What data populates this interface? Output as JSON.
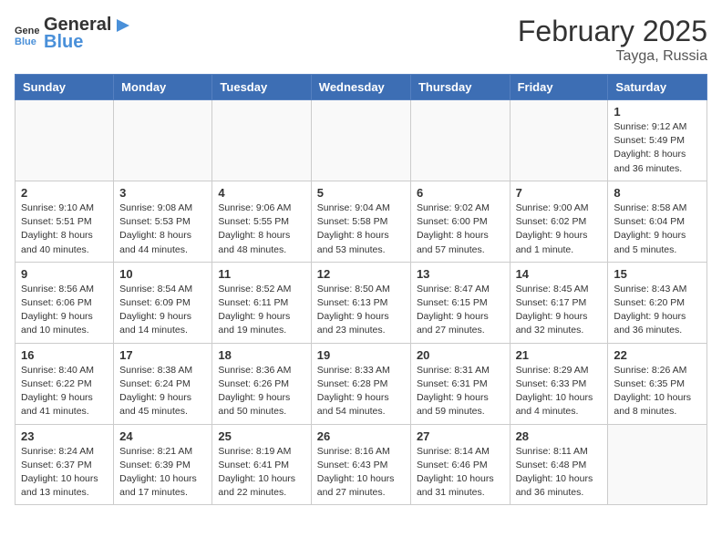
{
  "header": {
    "logo_general": "General",
    "logo_blue": "Blue",
    "month_year": "February 2025",
    "location": "Tayga, Russia"
  },
  "days_of_week": [
    "Sunday",
    "Monday",
    "Tuesday",
    "Wednesday",
    "Thursday",
    "Friday",
    "Saturday"
  ],
  "weeks": [
    [
      {
        "day": "",
        "info": ""
      },
      {
        "day": "",
        "info": ""
      },
      {
        "day": "",
        "info": ""
      },
      {
        "day": "",
        "info": ""
      },
      {
        "day": "",
        "info": ""
      },
      {
        "day": "",
        "info": ""
      },
      {
        "day": "1",
        "info": "Sunrise: 9:12 AM\nSunset: 5:49 PM\nDaylight: 8 hours and 36 minutes."
      }
    ],
    [
      {
        "day": "2",
        "info": "Sunrise: 9:10 AM\nSunset: 5:51 PM\nDaylight: 8 hours and 40 minutes."
      },
      {
        "day": "3",
        "info": "Sunrise: 9:08 AM\nSunset: 5:53 PM\nDaylight: 8 hours and 44 minutes."
      },
      {
        "day": "4",
        "info": "Sunrise: 9:06 AM\nSunset: 5:55 PM\nDaylight: 8 hours and 48 minutes."
      },
      {
        "day": "5",
        "info": "Sunrise: 9:04 AM\nSunset: 5:58 PM\nDaylight: 8 hours and 53 minutes."
      },
      {
        "day": "6",
        "info": "Sunrise: 9:02 AM\nSunset: 6:00 PM\nDaylight: 8 hours and 57 minutes."
      },
      {
        "day": "7",
        "info": "Sunrise: 9:00 AM\nSunset: 6:02 PM\nDaylight: 9 hours and 1 minute."
      },
      {
        "day": "8",
        "info": "Sunrise: 8:58 AM\nSunset: 6:04 PM\nDaylight: 9 hours and 5 minutes."
      }
    ],
    [
      {
        "day": "9",
        "info": "Sunrise: 8:56 AM\nSunset: 6:06 PM\nDaylight: 9 hours and 10 minutes."
      },
      {
        "day": "10",
        "info": "Sunrise: 8:54 AM\nSunset: 6:09 PM\nDaylight: 9 hours and 14 minutes."
      },
      {
        "day": "11",
        "info": "Sunrise: 8:52 AM\nSunset: 6:11 PM\nDaylight: 9 hours and 19 minutes."
      },
      {
        "day": "12",
        "info": "Sunrise: 8:50 AM\nSunset: 6:13 PM\nDaylight: 9 hours and 23 minutes."
      },
      {
        "day": "13",
        "info": "Sunrise: 8:47 AM\nSunset: 6:15 PM\nDaylight: 9 hours and 27 minutes."
      },
      {
        "day": "14",
        "info": "Sunrise: 8:45 AM\nSunset: 6:17 PM\nDaylight: 9 hours and 32 minutes."
      },
      {
        "day": "15",
        "info": "Sunrise: 8:43 AM\nSunset: 6:20 PM\nDaylight: 9 hours and 36 minutes."
      }
    ],
    [
      {
        "day": "16",
        "info": "Sunrise: 8:40 AM\nSunset: 6:22 PM\nDaylight: 9 hours and 41 minutes."
      },
      {
        "day": "17",
        "info": "Sunrise: 8:38 AM\nSunset: 6:24 PM\nDaylight: 9 hours and 45 minutes."
      },
      {
        "day": "18",
        "info": "Sunrise: 8:36 AM\nSunset: 6:26 PM\nDaylight: 9 hours and 50 minutes."
      },
      {
        "day": "19",
        "info": "Sunrise: 8:33 AM\nSunset: 6:28 PM\nDaylight: 9 hours and 54 minutes."
      },
      {
        "day": "20",
        "info": "Sunrise: 8:31 AM\nSunset: 6:31 PM\nDaylight: 9 hours and 59 minutes."
      },
      {
        "day": "21",
        "info": "Sunrise: 8:29 AM\nSunset: 6:33 PM\nDaylight: 10 hours and 4 minutes."
      },
      {
        "day": "22",
        "info": "Sunrise: 8:26 AM\nSunset: 6:35 PM\nDaylight: 10 hours and 8 minutes."
      }
    ],
    [
      {
        "day": "23",
        "info": "Sunrise: 8:24 AM\nSunset: 6:37 PM\nDaylight: 10 hours and 13 minutes."
      },
      {
        "day": "24",
        "info": "Sunrise: 8:21 AM\nSunset: 6:39 PM\nDaylight: 10 hours and 17 minutes."
      },
      {
        "day": "25",
        "info": "Sunrise: 8:19 AM\nSunset: 6:41 PM\nDaylight: 10 hours and 22 minutes."
      },
      {
        "day": "26",
        "info": "Sunrise: 8:16 AM\nSunset: 6:43 PM\nDaylight: 10 hours and 27 minutes."
      },
      {
        "day": "27",
        "info": "Sunrise: 8:14 AM\nSunset: 6:46 PM\nDaylight: 10 hours and 31 minutes."
      },
      {
        "day": "28",
        "info": "Sunrise: 8:11 AM\nSunset: 6:48 PM\nDaylight: 10 hours and 36 minutes."
      },
      {
        "day": "",
        "info": ""
      }
    ]
  ]
}
